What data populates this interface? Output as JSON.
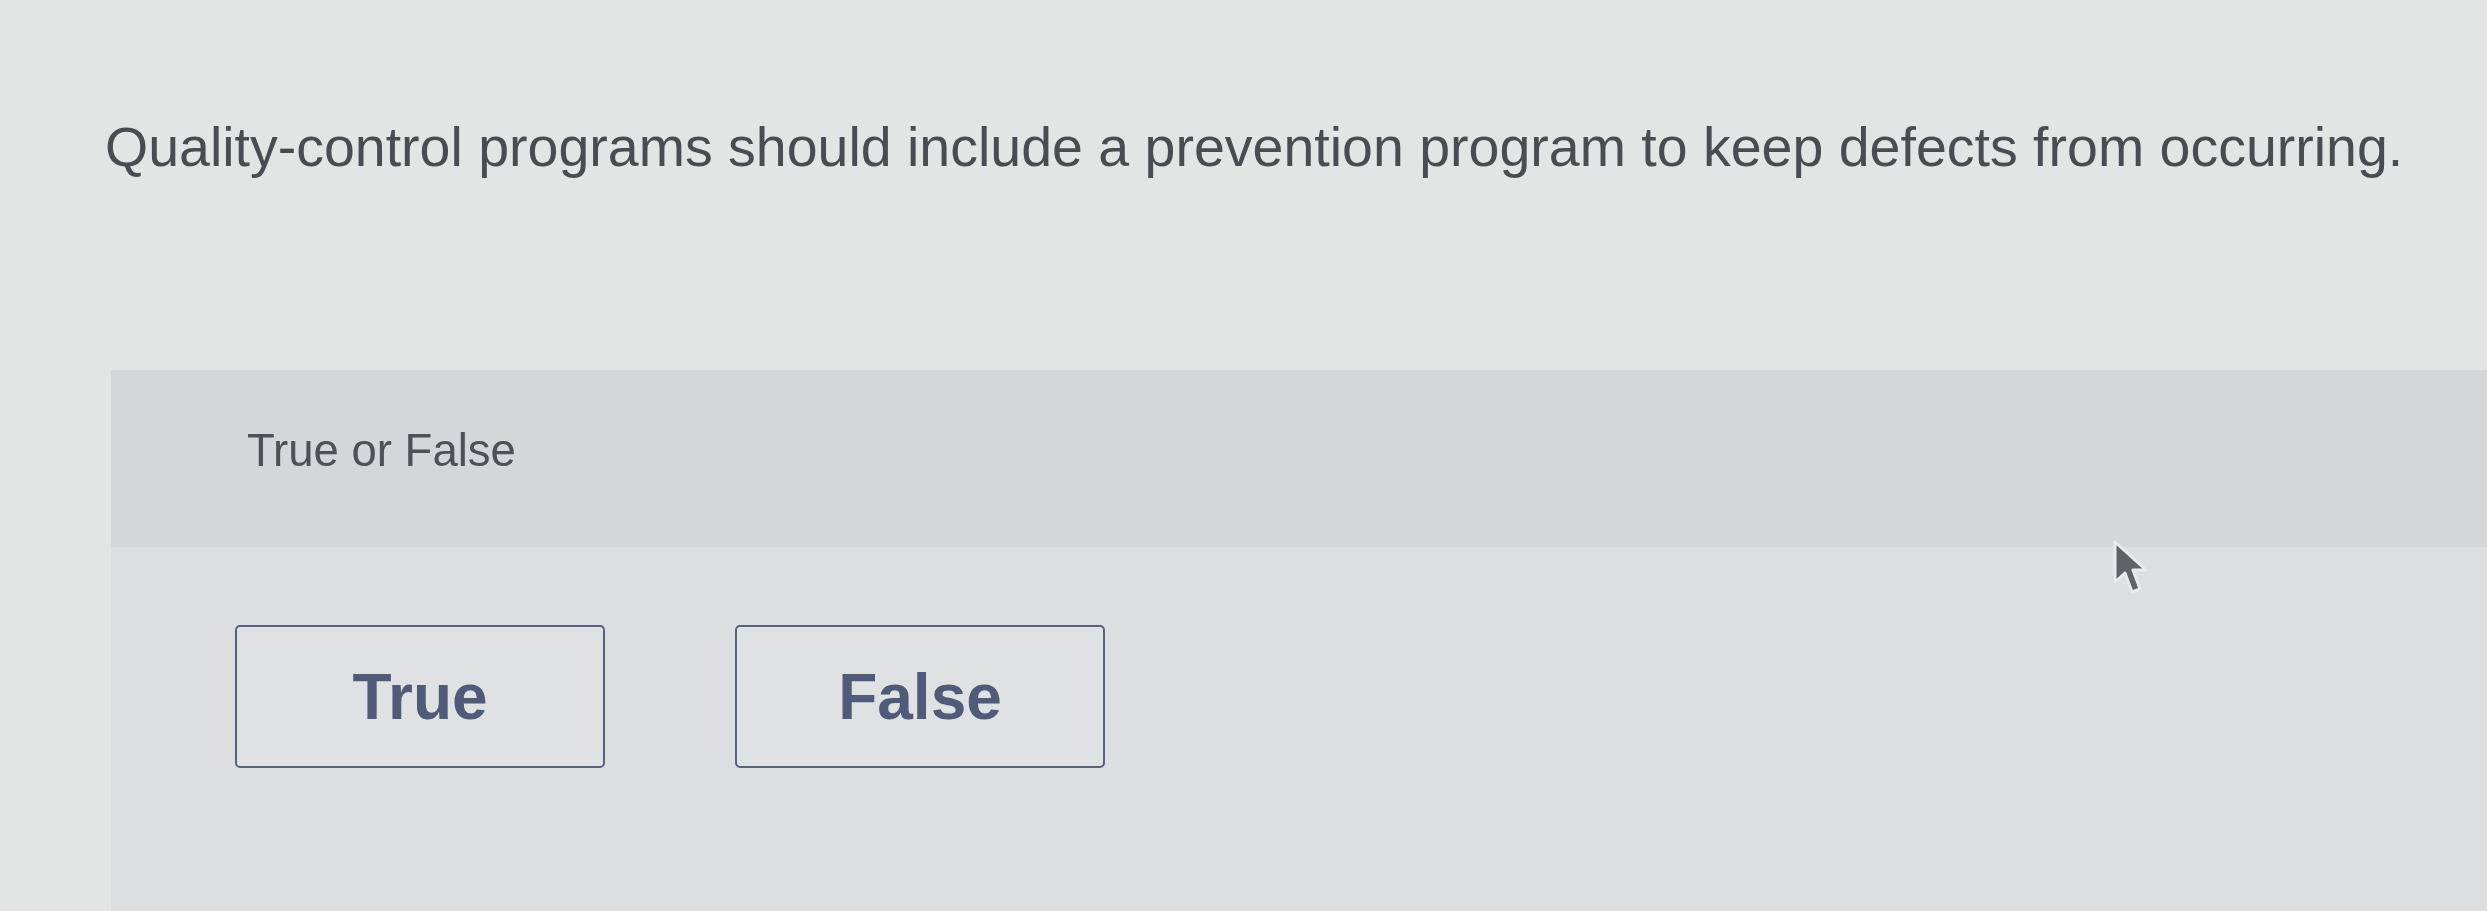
{
  "question": {
    "text": "Quality-control programs should include a prevention program to keep defects from occurring."
  },
  "prompt": {
    "label": "True or False"
  },
  "choices": [
    {
      "label": "True",
      "selected": false
    },
    {
      "label": "False",
      "selected": false
    }
  ]
}
